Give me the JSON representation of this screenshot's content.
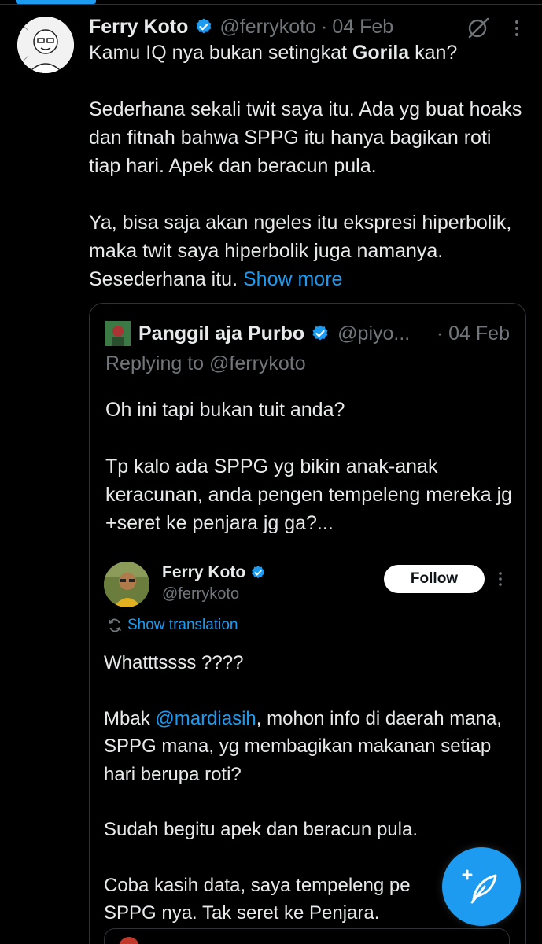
{
  "tweet": {
    "display_name": "Ferry Koto",
    "handle": "@ferrykoto",
    "separator": "·",
    "date": "04 Feb",
    "text_line1_pre": "Kamu IQ nya bukan setingkat ",
    "text_line1_bold": "Gorila",
    "text_line1_post": " kan?",
    "paragraph2": "Sederhana sekali twit saya itu. Ada yg buat hoaks dan fitnah bahwa SPPG itu hanya bagikan roti tiap hari. Apek dan beracun pula.",
    "paragraph3": "Ya, bisa saja akan ngeles itu ekspresi hiperbolik, maka twit saya hiperbolik juga namanya. Sesederhana itu.",
    "show_more": "Show more"
  },
  "quote": {
    "display_name": "Panggil aja Purbo",
    "handle": "@piyo...",
    "separator": "·",
    "date": "04 Feb",
    "replying_to": "Replying to @ferrykoto",
    "paragraph1": "Oh ini tapi bukan tuit anda?",
    "paragraph2": "Tp kalo ada SPPG yg bikin anak-anak keracunan, anda pengen tempeleng mereka jg +seret ke penjara jg ga?..."
  },
  "embedded": {
    "display_name": "Ferry Koto",
    "handle": "@ferrykoto",
    "follow_label": "Follow",
    "show_translation": "Show translation",
    "line1": "Whatttssss ????",
    "para2_pre": "Mbak ",
    "para2_mention": "@mardiasih",
    "para2_post": ", mohon info di daerah mana, SPPG mana, yg membagikan makanan setiap hari berupa roti?",
    "para3": "Sudah begitu apek dan beracun pula.",
    "para4": "Coba kasih data, saya tempeleng pe",
    "para4_line2": "SPPG nya. Tak seret ke Penjara."
  },
  "icons": {
    "verified": "verified-badge-icon",
    "grok": "grok-icon",
    "more": "more-dots-icon",
    "translate": "translate-icon",
    "compose": "compose-post-icon"
  },
  "colors": {
    "background": "#000000",
    "accent": "#1d9bf0",
    "text_primary": "#e7e9ea",
    "text_secondary": "#71767b",
    "border": "#2f3336"
  }
}
